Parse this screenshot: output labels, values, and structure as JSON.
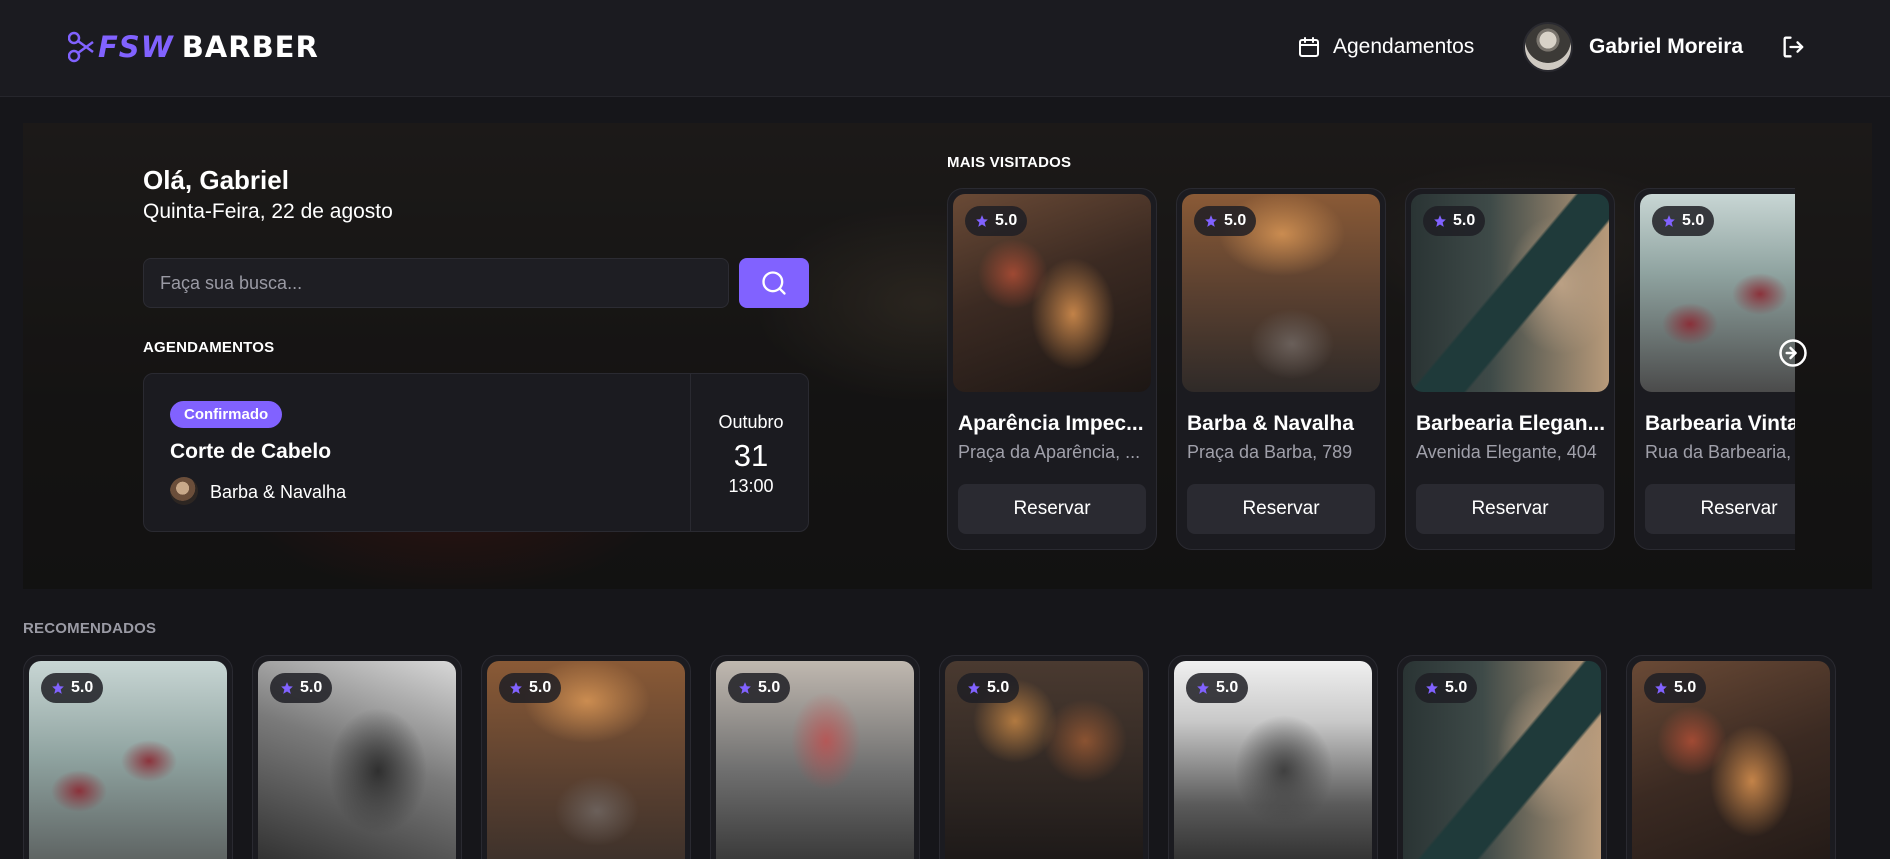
{
  "header": {
    "logo_fsw": "FSW",
    "logo_barber": "BARBER",
    "bookings_label": "Agendamentos",
    "user_name": "Gabriel Moreira"
  },
  "hero": {
    "greeting": "Olá, Gabriel",
    "date": "Quinta-Feira, 22 de agosto",
    "search_placeholder": "Faça sua busca...",
    "bookings_title": "AGENDAMENTOS",
    "booking": {
      "status": "Confirmado",
      "service": "Corte de Cabelo",
      "shop": "Barba & Navalha",
      "month": "Outubro",
      "day": "31",
      "time": "13:00"
    },
    "popular_title": "MAIS VISITADOS",
    "popular": [
      {
        "rating": "5.0",
        "name": "Aparência Impec...",
        "address": "Praça da Aparência, ...",
        "button": "Reservar"
      },
      {
        "rating": "5.0",
        "name": "Barba & Navalha",
        "address": "Praça da Barba, 789",
        "button": "Reservar"
      },
      {
        "rating": "5.0",
        "name": "Barbearia Elegan...",
        "address": "Avenida Elegante, 404",
        "button": "Reservar"
      },
      {
        "rating": "5.0",
        "name": "Barbearia Vinta",
        "address": "Rua da Barbearia,",
        "button": "Reservar"
      }
    ]
  },
  "recommended": {
    "title": "RECOMENDADOS",
    "items": [
      {
        "rating": "5.0"
      },
      {
        "rating": "5.0"
      },
      {
        "rating": "5.0"
      },
      {
        "rating": "5.0"
      },
      {
        "rating": "5.0"
      },
      {
        "rating": "5.0"
      },
      {
        "rating": "5.0"
      },
      {
        "rating": "5.0"
      }
    ]
  },
  "colors": {
    "accent": "#8162ff",
    "background": "#16161a",
    "card": "#1b1b20",
    "muted_text": "#a0a0aa"
  },
  "icons": [
    "scissors-logo-icon",
    "calendar-icon",
    "logout-icon",
    "search-icon",
    "star-icon",
    "chevron-right-circle-icon"
  ]
}
